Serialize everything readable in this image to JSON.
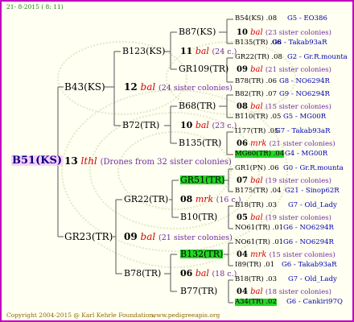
{
  "header": "21-  8-2015 (  8: 11)",
  "footer": {
    "copyright": "Copyright 2004-2015 @ Karl Kehrle Foundation.",
    "url": "www.pedigreeapis.org"
  },
  "colors": {
    "frame": "#c000c0",
    "highlight": "#24d424",
    "label": "#0000b0",
    "sister": "#6f2a9f",
    "mating": "#d40000"
  },
  "tree": {
    "root": {
      "name": "B51(KS)",
      "queen_number": "13",
      "mating": "lthl",
      "colonies": "(Drones from 32 sister colonies)"
    },
    "dam_line": {
      "B43": {
        "name": "B43(KS)",
        "queen_number": "12",
        "mating": "bal",
        "colonies": "(24 sister colonies)"
      },
      "B123": {
        "name": "B123(KS)",
        "queen_number": "11",
        "mating": "bal",
        "colonies": "(24 c.)"
      },
      "B87": {
        "name": "B87(KS)",
        "queen_number": "10",
        "mating": "bal",
        "colonies": "(23 sister colonies)"
      },
      "GR109": {
        "name": "GR109(TR)",
        "queen_number": "09",
        "mating": "bal",
        "colonies": "(21 sister colonies)"
      },
      "B72": {
        "name": "B72(TR)",
        "queen_number": "10",
        "mating": "bal",
        "colonies": "(23 c.)"
      },
      "B68": {
        "name": "B68(TR)",
        "queen_number": "08",
        "mating": "bal",
        "colonies": "(15 sister colonies)"
      },
      "B135": {
        "name": "B135(TR)",
        "queen_number": "06",
        "mating": "mrk",
        "colonies": "(21 sister colonies)"
      }
    },
    "sire_line": {
      "GR23": {
        "name": "GR23(TR)",
        "queen_number": "09",
        "mating": "bal",
        "colonies": "(21 sister colonies)"
      },
      "GR22": {
        "name": "GR22(TR)",
        "queen_number": "08",
        "mating": "mrk",
        "colonies": "(16 c.)"
      },
      "GR51": {
        "name": "GR51(TR)",
        "queen_number": "07",
        "mating": "bal",
        "colonies": "(19 sister colonies)"
      },
      "B10": {
        "name": "B10(TR)",
        "queen_number": "05",
        "mating": "bal",
        "colonies": "(19 sister colonies)"
      },
      "B78": {
        "name": "B78(TR)",
        "queen_number": "06",
        "mating": "bal",
        "colonies": "(18 c.)"
      },
      "B132": {
        "name": "B132(TR)",
        "queen_number": "04",
        "mating": "mrk",
        "colonies": "(15 sister colonies)"
      },
      "B77": {
        "name": "B77(TR)",
        "queen_number": "04",
        "mating": "bal",
        "colonies": "(18 sister colonies)"
      }
    },
    "leaves": [
      {
        "name": "B54(KS)",
        "num": ".08",
        "label": "G5 - EO386"
      },
      {
        "name": "B135(TR)",
        "num": ".06",
        "label": "G8 - Takab93aR"
      },
      {
        "name": "GR22(TR)",
        "num": ".08",
        "label": "G2 - Gr.R.mounta"
      },
      {
        "name": "B78(TR)",
        "num": ".06",
        "label": "G8 - NO6294R"
      },
      {
        "name": "B82(TR)",
        "num": ".07",
        "label": "G9 - NO6294R"
      },
      {
        "name": "B110(TR)",
        "num": ".05",
        "label": "G5 - MG00R"
      },
      {
        "name": "I177(TR)",
        "num": ".05",
        "label": "G7 - Takab93aR"
      },
      {
        "name": "MG60(TR)",
        "num": ".04",
        "label": "G4 - MG00R"
      },
      {
        "name": "GR1(PN)",
        "num": ".06",
        "label": "G0 - Gr.R.mounta"
      },
      {
        "name": "B175(TR)",
        "num": ".04",
        "label": "G21 - Sinop62R"
      },
      {
        "name": "B18(TR)",
        "num": ".03",
        "label": "G7 - Old_Lady"
      },
      {
        "name": "NO61(TR)",
        "num": ".01",
        "label": "G6 - NO6294R"
      },
      {
        "name": "NO61(TR)",
        "num": ".01",
        "label": "G6 - NO6294R"
      },
      {
        "name": "I89(TR)",
        "num": ".01",
        "label": "G6 - Takab93aR"
      },
      {
        "name": "B18(TR)",
        "num": ".03",
        "label": "G7 - Old_Lady"
      },
      {
        "name": "A34(TR)",
        "num": ".02",
        "label": "G6 - Cankiri97Q"
      }
    ]
  }
}
